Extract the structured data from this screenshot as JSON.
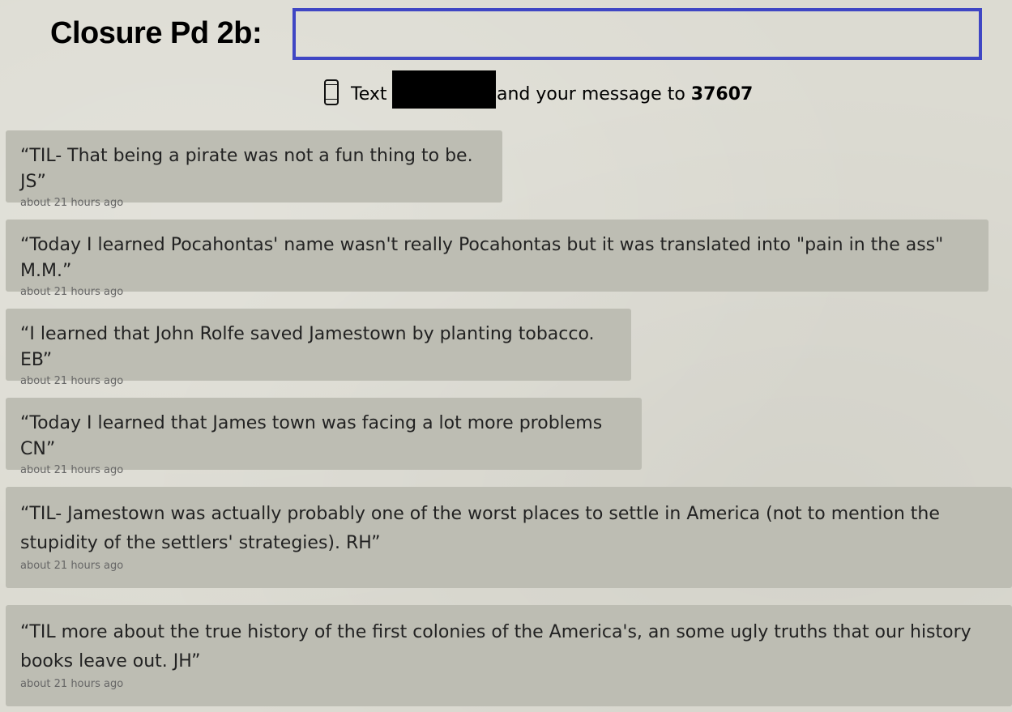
{
  "header": {
    "title": "Closure Pd 2b:"
  },
  "instruction": {
    "icon": "phone-icon",
    "text_prefix": "Text",
    "text_middle": "and your message to",
    "code": "37607"
  },
  "responses": [
    {
      "message": "“TIL- That being a pirate was not a fun thing to be. JS”",
      "time": "about 21 hours ago"
    },
    {
      "message": "“Today I learned Pocahontas' name wasn't really Pocahontas but it was translated into \"pain in the ass\" M.M.”",
      "time": "about 21 hours ago"
    },
    {
      "message": "“I learned that John Rolfe saved Jamestown by planting tobacco. EB”",
      "time": "about 21 hours ago"
    },
    {
      "message": "“Today I learned that James town was facing a lot more problems CN”",
      "time": "about 21 hours ago"
    },
    {
      "message": "“TIL- Jamestown was actually probably one of the worst places to settle in America (not to mention the stupidity of the settlers' strategies). RH”",
      "time": "about 21 hours ago"
    },
    {
      "message": "“TIL more about the true history of the first colonies of the America's, an some ugly truths that our history books leave out. JH”",
      "time": "about 21 hours ago"
    }
  ],
  "colors": {
    "background": "#dcdbd2",
    "card": "#bdbdb3",
    "name_box_border": "#3f46c4",
    "redaction": "#000000"
  }
}
